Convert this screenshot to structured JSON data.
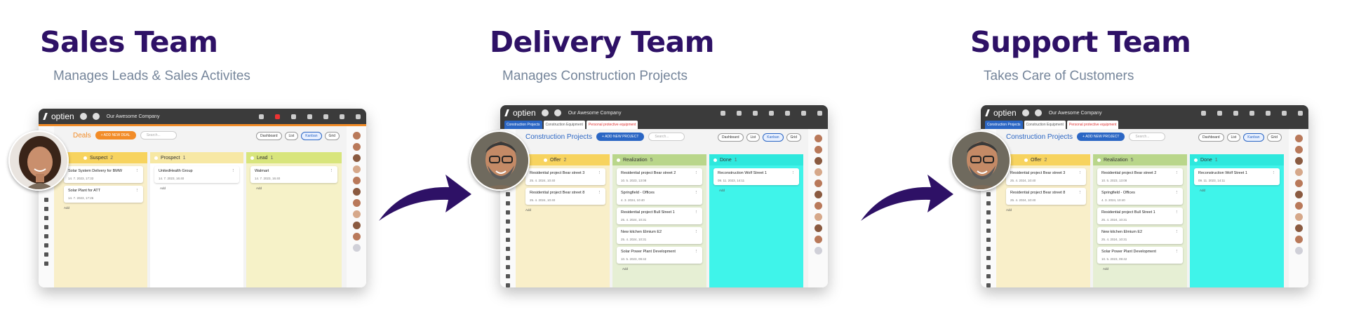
{
  "panels": [
    {
      "title": "Sales Team",
      "subtitle": "Manages Leads & Sales Activites",
      "app": {
        "logo": "optien",
        "company": "Our Awesome Company",
        "board_title": "Deals",
        "add_button": "+ ADD NEW DEAL",
        "search_placeholder": "Search...",
        "views": [
          "Dashboard",
          "List",
          "Kanban",
          "Grid"
        ],
        "columns": [
          {
            "name": "Suspect",
            "count": "2",
            "cards": [
              {
                "title": "Solar System Delivery for BMW",
                "date": "14. 7. 2023, 17:33"
              },
              {
                "title": "Solar Plant for ATT",
                "date": "14. 7. 2023, 17:26"
              }
            ],
            "add": "Add"
          },
          {
            "name": "Prospect",
            "count": "1",
            "cards": [
              {
                "title": "UnitedHealth Group",
                "date": "14. 7. 2023, 16:40"
              }
            ],
            "add": "Add"
          },
          {
            "name": "Lead",
            "count": "1",
            "cards": [
              {
                "title": "Walmart",
                "date": "14. 7. 2023, 16:40"
              }
            ],
            "add": "Add"
          }
        ]
      }
    },
    {
      "title": "Delivery Team",
      "subtitle": "Manages Construction Projects",
      "app": {
        "logo": "optien",
        "company": "Our Awesome Company",
        "tabs": [
          "Construction Projects",
          "Construction Equipment",
          "Personal protective equipment"
        ],
        "board_title": "Construction Projects",
        "add_button": "+ ADD NEW PROJECT",
        "search_placeholder": "Search...",
        "views": [
          "Dashboard",
          "List",
          "Kanban",
          "Grid"
        ],
        "columns": [
          {
            "name": "Offer",
            "count": "2",
            "cards": [
              {
                "title": "Residential project Bear street 3",
                "date": "25. 4. 2024, 10:40"
              },
              {
                "title": "Residential project Bear street 8",
                "date": "25. 4. 2024, 10:40"
              }
            ],
            "add": "Add"
          },
          {
            "name": "Realization",
            "count": "5",
            "cards": [
              {
                "title": "Residential project Bear street 2",
                "date": "10. 5. 2023, 13:08"
              },
              {
                "title": "Springfield - Offices",
                "date": "4. 3. 2024, 10:40"
              },
              {
                "title": "Residential project Bull Street 1",
                "date": "25. 4. 2024, 10:31"
              },
              {
                "title": "New kitchen Elmium E2",
                "date": "25. 4. 2024, 10:31"
              },
              {
                "title": "Solar Power Plant Development",
                "date": "10. 5. 2023, 09:42"
              }
            ],
            "add": "Add"
          },
          {
            "name": "Done",
            "count": "1",
            "cards": [
              {
                "title": "Reconstruction Wolf Street 1",
                "date": "09. 11. 2023, 14:11"
              }
            ],
            "add": "Add"
          }
        ]
      }
    },
    {
      "title": "Support Team",
      "subtitle": "Takes Care of Customers",
      "app": {
        "logo": "optien",
        "company": "Our Awesome Company",
        "tabs": [
          "Construction Projects",
          "Construction Equipment",
          "Personal protective equipment"
        ],
        "board_title": "Construction Projects",
        "add_button": "+ ADD NEW PROJECT",
        "search_placeholder": "Search...",
        "views": [
          "Dashboard",
          "List",
          "Kanban",
          "Grid"
        ],
        "columns": [
          {
            "name": "Offer",
            "count": "2",
            "cards": [
              {
                "title": "Residential project Bear street 3",
                "date": "25. 4. 2024, 10:40"
              },
              {
                "title": "Residential project Bear street 8",
                "date": "25. 4. 2024, 10:40"
              }
            ],
            "add": "Add"
          },
          {
            "name": "Realization",
            "count": "5",
            "cards": [
              {
                "title": "Residential project Bear street 2",
                "date": "10. 5. 2023, 13:08"
              },
              {
                "title": "Springfield - Offices",
                "date": "4. 3. 2024, 10:40"
              },
              {
                "title": "Residential project Bull Street 1",
                "date": "25. 4. 2024, 10:31"
              },
              {
                "title": "New kitchen Elmium E2",
                "date": "25. 4. 2024, 10:31"
              },
              {
                "title": "Solar Power Plant Development",
                "date": "10. 5. 2023, 09:42"
              }
            ],
            "add": "Add"
          },
          {
            "name": "Done",
            "count": "1",
            "cards": [
              {
                "title": "Reconstruction Wolf Street 1",
                "date": "09. 11. 2023, 14:11"
              }
            ],
            "add": "Add"
          }
        ]
      }
    }
  ],
  "colors": {
    "title": "#2e1166",
    "subtitle": "#76869b",
    "sales_accent": "#f28c28",
    "delivery_accent": "#2b66c4",
    "column_yellow": "#f9efc9",
    "column_green": "#e6efd4",
    "column_cyan": "#3ff4ea"
  }
}
